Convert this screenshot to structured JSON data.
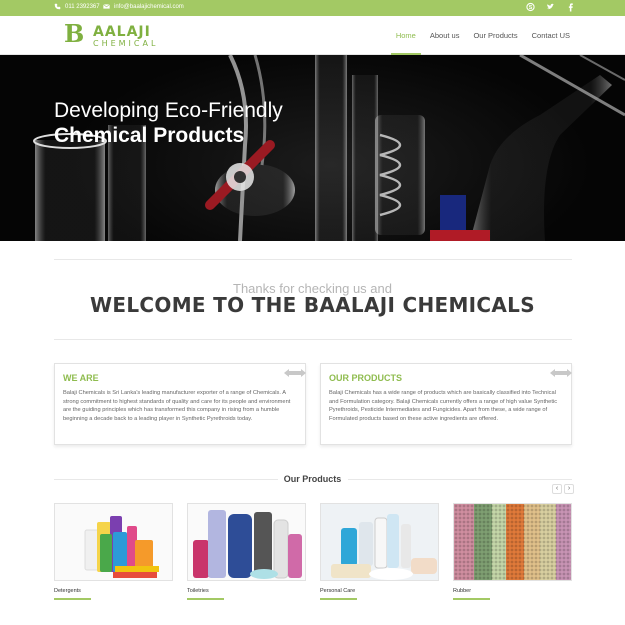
{
  "topbar": {
    "phone": "011 2392367",
    "email": "info@baalajichemical.com",
    "social_icons": [
      "skype-icon",
      "twitter-icon",
      "facebook-icon"
    ]
  },
  "header": {
    "logo_initial": "B",
    "logo_word": "AALAJI",
    "logo_sub": "CHEMICAL",
    "nav": [
      {
        "label": "Home",
        "active": true
      },
      {
        "label": "About us",
        "active": false
      },
      {
        "label": "Our Products",
        "active": false
      },
      {
        "label": "Contact US",
        "active": false
      }
    ]
  },
  "hero": {
    "line1": "Developing Eco-Friendly",
    "line2": "Chemical Products"
  },
  "welcome": {
    "thanks": "Thanks for checking us and",
    "title": "WELCOME TO THE BAALAJI CHEMICALS"
  },
  "boxes": {
    "we_are": {
      "title": "WE ARE",
      "text": "Balaji Chemicals is Sri Lanka's leading manufacturer exporter of a range of Chemicals. A strong commitment to highest standards of quality and care for its people and environment are the guiding principles which has transformed this company in rising from a humble beginning a decade back to a leading player in Synthetic Pyrethroids today."
    },
    "our_products": {
      "title": "OUR PRODUCTS",
      "text": "Balaji Chemicals has a wide range of products which are basically classified into Technical and Formulation category. Balaji Chemicals currently offers a range of high value Synthetic Pyrethroids, Pesticide Intermediates and Fungicides. Apart from these, a wide range of Formulated products based on these active ingredients are offered."
    }
  },
  "products": {
    "heading": "Our Products",
    "prev": "‹",
    "next": "›",
    "items": [
      {
        "label": "Detergents"
      },
      {
        "label": "Toiletries"
      },
      {
        "label": "Personal Care"
      },
      {
        "label": "Rubber"
      }
    ]
  },
  "colors": {
    "accent": "#a3c964",
    "accent_text": "#8fbc4f",
    "hero_bg": "#050505"
  }
}
